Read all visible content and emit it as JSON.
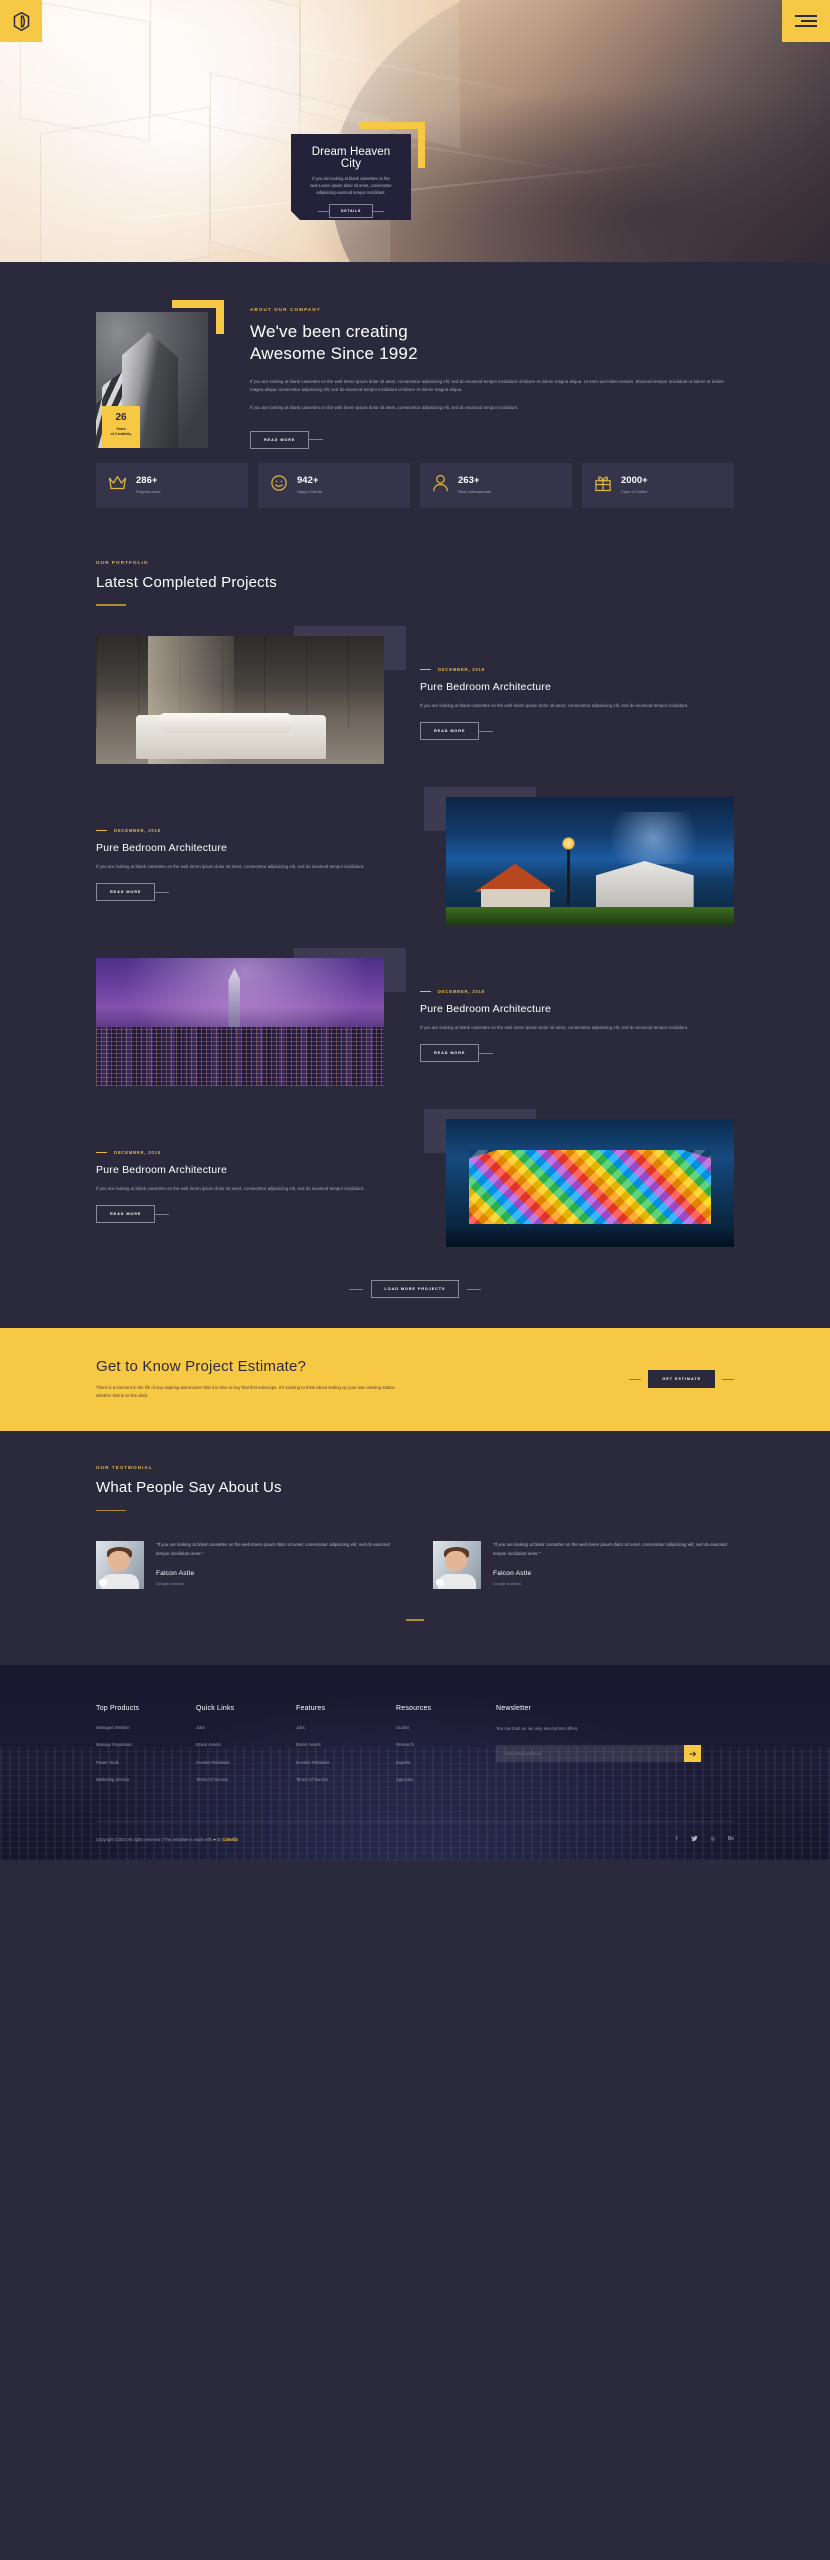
{
  "colors": {
    "accent": "#f7c843",
    "dark": "#2b2a3c",
    "card": "#35344a",
    "muted": "#a9a7b7",
    "gold_rule": "#b08b36"
  },
  "header": {
    "logo_icon": "hexagon-monogram-icon",
    "menu_icon": "hamburger-menu-icon"
  },
  "hero": {
    "card_title": "Dream Heaven City",
    "card_text": "If you are looking at blank cassettes on the web Lorem ipsum dolor sit amet, consectetur adipisicing eiusmod tempor incididunt.",
    "button_label": "DETAILS"
  },
  "about": {
    "eyebrow": "ABOUT OUR COMPANY",
    "title_line1": "We've been creating",
    "title_line2": "Awesome Since 1992",
    "paragraph1": "If you are looking at blank cassettes on the web lorem ipsum dolor sit amet, consectetur adipisicing elit, sed do eiusmod tempor incididunt ut labore et dolore magna aliqua. Ut enim ad minim veniam. Eiusmod tempor incididunt ut labore et dolore magna aliqua consectetur adipisicing elit, sed do eiusmod tempor incididunt ut labore et dolore magna aliqua.",
    "paragraph2": "If you are looking at blank cassettes on the web lorem ipsum dolor sit amet, consectetur adipisicing elit, sed do eiusmod tempor incididunt.",
    "button_label": "READ MORE",
    "badge_number": "26",
    "badge_line1": "Years",
    "badge_line2": "of Creativity"
  },
  "stats": [
    {
      "icon": "crown-icon",
      "value": "286+",
      "label": "Projects done"
    },
    {
      "icon": "smiley-icon",
      "value": "942+",
      "label": "Happy Clients"
    },
    {
      "icon": "person-icon",
      "value": "263+",
      "label": "Real professionals"
    },
    {
      "icon": "gift-icon",
      "value": "2000+",
      "label": "Cups of Coffee"
    }
  ],
  "portfolio": {
    "eyebrow": "OUR PORTFOLIO",
    "title": "Latest Completed Projects",
    "load_more_label": "LOAD MORE PROJECTS",
    "items": [
      {
        "date": "DECEMBER, 2018",
        "title": "Pure Bedroom Architecture",
        "text": "If you are looking at blank cassettes on the web lorem ipsum dolor sit amet, consectetur adipisicing elit, sed do eiusmod tempor incididunt.",
        "button_label": "READ MORE",
        "image": "bedroom-interior-photo"
      },
      {
        "date": "DECEMBER, 2018",
        "title": "Pure Bedroom Architecture",
        "text": "If you are looking at blank cassettes on the web lorem ipsum dolor sit amet, consectetur adipisicing elit, sed do eiusmod tempor incididunt.",
        "button_label": "READ MORE",
        "image": "night-house-photo"
      },
      {
        "date": "DECEMBER, 2018",
        "title": "Pure Bedroom Architecture",
        "text": "If you are looking at blank cassettes on the web lorem ipsum dolor sit amet, consectetur adipisicing elit, sed do eiusmod tempor incididunt.",
        "button_label": "READ MORE",
        "image": "purple-city-skyline-photo"
      },
      {
        "date": "DECEMBER, 2018",
        "title": "Pure Bedroom Architecture",
        "text": "If you are looking at blank cassettes on the web lorem ipsum dolor sit amet, consectetur adipisicing elit, sed do eiusmod tempor incididunt.",
        "button_label": "READ MORE",
        "image": "colorful-mural-building-photo"
      }
    ]
  },
  "estimate": {
    "title": "Get to Know Project Estimate?",
    "text": "There is a moment in the life of any aspiring astronomer that it is time to buy that first telescope. It's exciting to think about setting up your own viewing station whether that is on the deck.",
    "button_label": "GET ESTIMATE"
  },
  "testimonial": {
    "eyebrow": "OUR TESTMONIAL",
    "title": "What People Say About Us",
    "items": [
      {
        "quote": "\"If you are looking at blank cassettes on the web lorem ipsum dolor sit amet, consectetur adipisicing elit, sed do eiusmod tempor incididunt amet.\"",
        "name": "Falcon Astle",
        "role": "Google Android"
      },
      {
        "quote": "\"If you are looking at blank cassettes on the web lorem ipsum dolor sit amet, consectetur adipisicing elit, sed do eiusmod tempor incididunt amet.\"",
        "name": "Falcon Astle",
        "role": "Google Android"
      }
    ]
  },
  "footer": {
    "columns": [
      {
        "title": "Top Products",
        "links": [
          "Managed Website",
          "Manage Reputation",
          "Power Tools",
          "Marketing Service"
        ]
      },
      {
        "title": "Quick Links",
        "links": [
          "Jobs",
          "Brand Assets",
          "Investor Relations",
          "Terms Of Service"
        ]
      },
      {
        "title": "Features",
        "links": [
          "Jobs",
          "Brand Assets",
          "Investor Relations",
          "Terms Of Service"
        ]
      },
      {
        "title": "Resources",
        "links": [
          "Guides",
          "Research",
          "Experts",
          "Agencies"
        ]
      }
    ],
    "newsletter": {
      "title": "Newsletter",
      "text": "You can trust us. we only send promo offers,",
      "placeholder": "Your email address",
      "submit_icon": "arrow-right-icon"
    },
    "copyright_prefix": "Copyright ©2023 All rights reserved | This template is made with ",
    "copyright_heart": "♥",
    "copyright_by": " by ",
    "copyright_brand": "Colorlib",
    "socials": [
      {
        "icon": "facebook-icon",
        "glyph": "f"
      },
      {
        "icon": "twitter-icon",
        "glyph": "ᴠ"
      },
      {
        "icon": "dribbble-icon",
        "glyph": "◎"
      },
      {
        "icon": "behance-icon",
        "glyph": "Be"
      }
    ]
  }
}
